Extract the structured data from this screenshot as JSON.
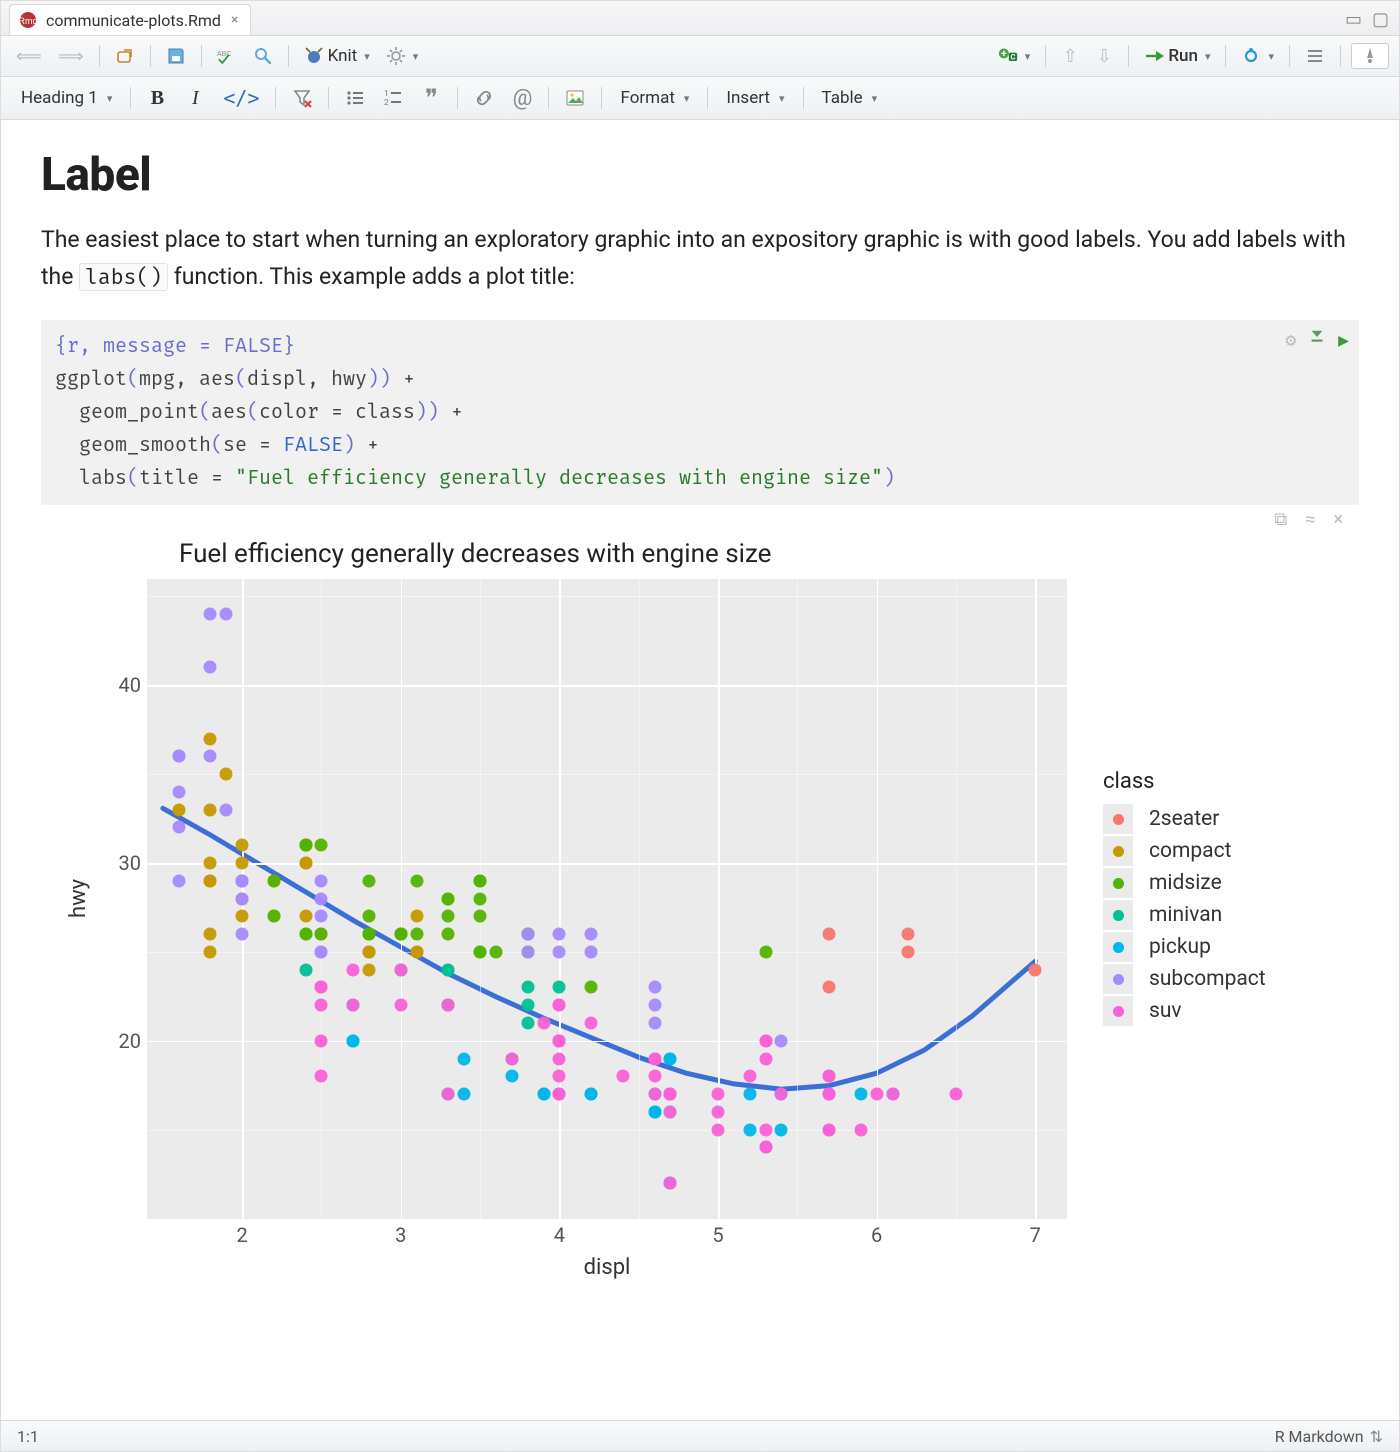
{
  "tabs": [
    {
      "label": "communicate-plots.Rmd"
    }
  ],
  "toolbar1": {
    "knit_label": "Knit",
    "run_label": "Run"
  },
  "toolbar2": {
    "heading_picker": "Heading 1",
    "format_menu": "Format",
    "insert_menu": "Insert",
    "table_menu": "Table"
  },
  "doc": {
    "heading": "Label",
    "p_before": "The easiest place to start when turning an exploratory graphic into an expository graphic is with good labels. You add labels with the ",
    "p_code": "labs()",
    "p_after": " function. This example adds a plot title:"
  },
  "chunk": {
    "header": "{r, message = FALSE}",
    "lines": [
      {
        "parts": [
          {
            "t": "fn",
            "v": "ggplot"
          },
          {
            "t": "paren",
            "v": "("
          },
          {
            "t": "arg",
            "v": "mpg, "
          },
          {
            "t": "fn",
            "v": "aes"
          },
          {
            "t": "paren",
            "v": "("
          },
          {
            "t": "arg",
            "v": "displ, hwy"
          },
          {
            "t": "paren",
            "v": "))"
          },
          {
            "t": "op",
            "v": " +"
          }
        ]
      },
      {
        "indent": 1,
        "parts": [
          {
            "t": "fn",
            "v": "geom_point"
          },
          {
            "t": "paren",
            "v": "("
          },
          {
            "t": "fn",
            "v": "aes"
          },
          {
            "t": "paren",
            "v": "("
          },
          {
            "t": "arg",
            "v": "color = class"
          },
          {
            "t": "paren",
            "v": "))"
          },
          {
            "t": "op",
            "v": " +"
          }
        ]
      },
      {
        "indent": 1,
        "parts": [
          {
            "t": "fn",
            "v": "geom_smooth"
          },
          {
            "t": "paren",
            "v": "("
          },
          {
            "t": "arg",
            "v": "se = "
          },
          {
            "t": "const",
            "v": "FALSE"
          },
          {
            "t": "paren",
            "v": ")"
          },
          {
            "t": "op",
            "v": " +"
          }
        ]
      },
      {
        "indent": 1,
        "parts": [
          {
            "t": "fn",
            "v": "labs"
          },
          {
            "t": "paren",
            "v": "("
          },
          {
            "t": "arg",
            "v": "title = "
          },
          {
            "t": "str",
            "v": "\"Fuel efficiency generally decreases with engine size\""
          },
          {
            "t": "paren",
            "v": ")"
          }
        ]
      }
    ]
  },
  "chart_data": {
    "type": "scatter",
    "title": "Fuel efficiency generally decreases with engine size",
    "xlabel": "displ",
    "ylabel": "hwy",
    "xlim": [
      1.4,
      7.2
    ],
    "ylim": [
      10,
      46
    ],
    "xticks": [
      2,
      3,
      4,
      5,
      6,
      7
    ],
    "yticks": [
      20,
      30,
      40
    ],
    "legend_title": "class",
    "colors": {
      "2seater": "#F8766D",
      "compact": "#C49A00",
      "midsize": "#53B400",
      "minivan": "#00C094",
      "pickup": "#00B6EB",
      "subcompact": "#A58AFF",
      "suv": "#FB61D7"
    },
    "series": [
      {
        "name": "2seater",
        "points": [
          {
            "x": 5.7,
            "y": 26
          },
          {
            "x": 5.7,
            "y": 23
          },
          {
            "x": 6.2,
            "y": 26
          },
          {
            "x": 6.2,
            "y": 25
          },
          {
            "x": 7.0,
            "y": 24
          }
        ]
      },
      {
        "name": "compact",
        "points": [
          {
            "x": 1.8,
            "y": 29
          },
          {
            "x": 1.8,
            "y": 29
          },
          {
            "x": 2.0,
            "y": 31
          },
          {
            "x": 2.0,
            "y": 30
          },
          {
            "x": 2.8,
            "y": 26
          },
          {
            "x": 2.8,
            "y": 26
          },
          {
            "x": 3.1,
            "y": 27
          },
          {
            "x": 1.8,
            "y": 26
          },
          {
            "x": 1.8,
            "y": 25
          },
          {
            "x": 2.0,
            "y": 28
          },
          {
            "x": 2.0,
            "y": 27
          },
          {
            "x": 2.8,
            "y": 25
          },
          {
            "x": 2.8,
            "y": 25
          },
          {
            "x": 3.1,
            "y": 25
          },
          {
            "x": 3.1,
            "y": 25
          },
          {
            "x": 2.4,
            "y": 30
          },
          {
            "x": 2.4,
            "y": 30
          },
          {
            "x": 2.5,
            "y": 26
          },
          {
            "x": 2.5,
            "y": 26
          },
          {
            "x": 1.8,
            "y": 37
          },
          {
            "x": 2.4,
            "y": 27
          },
          {
            "x": 2.2,
            "y": 29
          },
          {
            "x": 2.2,
            "y": 27
          },
          {
            "x": 2.4,
            "y": 31
          },
          {
            "x": 3.3,
            "y": 28
          },
          {
            "x": 1.6,
            "y": 33
          },
          {
            "x": 1.8,
            "y": 33
          },
          {
            "x": 1.8,
            "y": 30
          },
          {
            "x": 2.0,
            "y": 29
          },
          {
            "x": 2.0,
            "y": 29
          },
          {
            "x": 2.8,
            "y": 24
          },
          {
            "x": 1.9,
            "y": 35
          }
        ]
      },
      {
        "name": "midsize",
        "points": [
          {
            "x": 2.8,
            "y": 26
          },
          {
            "x": 2.8,
            "y": 26
          },
          {
            "x": 2.8,
            "y": 27
          },
          {
            "x": 3.0,
            "y": 26
          },
          {
            "x": 3.1,
            "y": 26
          },
          {
            "x": 4.2,
            "y": 23
          },
          {
            "x": 2.4,
            "y": 26
          },
          {
            "x": 2.4,
            "y": 31
          },
          {
            "x": 3.1,
            "y": 29
          },
          {
            "x": 2.4,
            "y": 26
          },
          {
            "x": 2.4,
            "y": 31
          },
          {
            "x": 3.5,
            "y": 29
          },
          {
            "x": 3.6,
            "y": 25
          },
          {
            "x": 3.5,
            "y": 28
          },
          {
            "x": 3.0,
            "y": 26
          },
          {
            "x": 3.0,
            "y": 26
          },
          {
            "x": 3.3,
            "y": 27
          },
          {
            "x": 3.3,
            "y": 26
          },
          {
            "x": 3.3,
            "y": 28
          },
          {
            "x": 3.8,
            "y": 25
          },
          {
            "x": 3.8,
            "y": 26
          },
          {
            "x": 3.8,
            "y": 26
          },
          {
            "x": 3.8,
            "y": 26
          },
          {
            "x": 2.2,
            "y": 29
          },
          {
            "x": 2.2,
            "y": 27
          },
          {
            "x": 2.4,
            "y": 31
          },
          {
            "x": 2.4,
            "y": 31
          },
          {
            "x": 3.0,
            "y": 26
          },
          {
            "x": 3.0,
            "y": 26
          },
          {
            "x": 5.3,
            "y": 25
          },
          {
            "x": 2.8,
            "y": 29
          },
          {
            "x": 3.5,
            "y": 25
          },
          {
            "x": 2.5,
            "y": 31
          },
          {
            "x": 3.5,
            "y": 29
          },
          {
            "x": 3.5,
            "y": 27
          },
          {
            "x": 3.5,
            "y": 25
          },
          {
            "x": 2.5,
            "y": 26
          }
        ]
      },
      {
        "name": "minivan",
        "points": [
          {
            "x": 2.4,
            "y": 24
          },
          {
            "x": 3.0,
            "y": 24
          },
          {
            "x": 3.3,
            "y": 22
          },
          {
            "x": 3.3,
            "y": 22
          },
          {
            "x": 3.3,
            "y": 24
          },
          {
            "x": 3.3,
            "y": 24
          },
          {
            "x": 3.3,
            "y": 17
          },
          {
            "x": 3.8,
            "y": 22
          },
          {
            "x": 3.8,
            "y": 21
          },
          {
            "x": 3.8,
            "y": 23
          },
          {
            "x": 4.0,
            "y": 23
          }
        ]
      },
      {
        "name": "pickup",
        "points": [
          {
            "x": 3.7,
            "y": 19
          },
          {
            "x": 3.7,
            "y": 18
          },
          {
            "x": 3.9,
            "y": 17
          },
          {
            "x": 3.9,
            "y": 17
          },
          {
            "x": 4.7,
            "y": 19
          },
          {
            "x": 4.7,
            "y": 19
          },
          {
            "x": 4.7,
            "y": 12
          },
          {
            "x": 5.2,
            "y": 17
          },
          {
            "x": 5.2,
            "y": 15
          },
          {
            "x": 5.9,
            "y": 17
          },
          {
            "x": 4.7,
            "y": 17
          },
          {
            "x": 4.7,
            "y": 17
          },
          {
            "x": 4.7,
            "y": 16
          },
          {
            "x": 4.7,
            "y": 12
          },
          {
            "x": 4.2,
            "y": 17
          },
          {
            "x": 4.2,
            "y": 17
          },
          {
            "x": 4.6,
            "y": 16
          },
          {
            "x": 4.6,
            "y": 16
          },
          {
            "x": 4.6,
            "y": 17
          },
          {
            "x": 5.4,
            "y": 17
          },
          {
            "x": 5.4,
            "y": 15
          },
          {
            "x": 2.7,
            "y": 20
          },
          {
            "x": 2.7,
            "y": 20
          },
          {
            "x": 2.7,
            "y": 22
          },
          {
            "x": 3.4,
            "y": 17
          },
          {
            "x": 3.4,
            "y": 19
          },
          {
            "x": 4.0,
            "y": 20
          },
          {
            "x": 4.0,
            "y": 17
          },
          {
            "x": 4.0,
            "y": 20
          },
          {
            "x": 4.7,
            "y": 17
          },
          {
            "x": 5.7,
            "y": 17
          },
          {
            "x": 6.1,
            "y": 17
          }
        ]
      },
      {
        "name": "subcompact",
        "points": [
          {
            "x": 3.8,
            "y": 26
          },
          {
            "x": 3.8,
            "y": 25
          },
          {
            "x": 4.0,
            "y": 26
          },
          {
            "x": 4.0,
            "y": 25
          },
          {
            "x": 4.6,
            "y": 23
          },
          {
            "x": 4.6,
            "y": 22
          },
          {
            "x": 1.6,
            "y": 29
          },
          {
            "x": 1.6,
            "y": 32
          },
          {
            "x": 1.6,
            "y": 34
          },
          {
            "x": 1.6,
            "y": 36
          },
          {
            "x": 1.6,
            "y": 36
          },
          {
            "x": 1.8,
            "y": 36
          },
          {
            "x": 4.6,
            "y": 21
          },
          {
            "x": 4.2,
            "y": 25
          },
          {
            "x": 4.2,
            "y": 26
          },
          {
            "x": 5.4,
            "y": 20
          },
          {
            "x": 2.0,
            "y": 26
          },
          {
            "x": 2.0,
            "y": 29
          },
          {
            "x": 1.9,
            "y": 33
          },
          {
            "x": 2.0,
            "y": 28
          },
          {
            "x": 2.5,
            "y": 28
          },
          {
            "x": 2.5,
            "y": 25
          },
          {
            "x": 2.5,
            "y": 27
          },
          {
            "x": 2.5,
            "y": 25
          },
          {
            "x": 1.8,
            "y": 41
          },
          {
            "x": 1.8,
            "y": 44
          },
          {
            "x": 1.9,
            "y": 44
          },
          {
            "x": 2.0,
            "y": 29
          },
          {
            "x": 2.5,
            "y": 29
          }
        ]
      },
      {
        "name": "suv",
        "points": [
          {
            "x": 5.3,
            "y": 20
          },
          {
            "x": 5.3,
            "y": 15
          },
          {
            "x": 5.3,
            "y": 20
          },
          {
            "x": 5.7,
            "y": 17
          },
          {
            "x": 6.0,
            "y": 17
          },
          {
            "x": 5.7,
            "y": 15
          },
          {
            "x": 5.3,
            "y": 14
          },
          {
            "x": 5.3,
            "y": 19
          },
          {
            "x": 5.3,
            "y": 14
          },
          {
            "x": 5.7,
            "y": 15
          },
          {
            "x": 6.5,
            "y": 17
          },
          {
            "x": 3.9,
            "y": 21
          },
          {
            "x": 4.7,
            "y": 16
          },
          {
            "x": 4.7,
            "y": 12
          },
          {
            "x": 4.7,
            "y": 17
          },
          {
            "x": 5.2,
            "y": 18
          },
          {
            "x": 5.7,
            "y": 18
          },
          {
            "x": 5.9,
            "y": 15
          },
          {
            "x": 5.0,
            "y": 16
          },
          {
            "x": 4.0,
            "y": 17
          },
          {
            "x": 4.0,
            "y": 19
          },
          {
            "x": 4.6,
            "y": 17
          },
          {
            "x": 5.0,
            "y": 17
          },
          {
            "x": 5.4,
            "y": 17
          },
          {
            "x": 4.0,
            "y": 22
          },
          {
            "x": 4.0,
            "y": 22
          },
          {
            "x": 4.0,
            "y": 20
          },
          {
            "x": 4.0,
            "y": 17
          },
          {
            "x": 4.6,
            "y": 19
          },
          {
            "x": 5.0,
            "y": 15
          },
          {
            "x": 4.2,
            "y": 21
          },
          {
            "x": 4.4,
            "y": 18
          },
          {
            "x": 4.6,
            "y": 18
          },
          {
            "x": 4.6,
            "y": 19
          },
          {
            "x": 4.6,
            "y": 19
          },
          {
            "x": 3.0,
            "y": 22
          },
          {
            "x": 3.7,
            "y": 19
          },
          {
            "x": 4.0,
            "y": 20
          },
          {
            "x": 4.7,
            "y": 17
          },
          {
            "x": 5.7,
            "y": 18
          },
          {
            "x": 6.1,
            "y": 17
          },
          {
            "x": 2.7,
            "y": 24
          },
          {
            "x": 2.7,
            "y": 22
          },
          {
            "x": 3.0,
            "y": 24
          },
          {
            "x": 3.3,
            "y": 22
          },
          {
            "x": 4.0,
            "y": 18
          },
          {
            "x": 3.3,
            "y": 17
          },
          {
            "x": 2.5,
            "y": 22
          },
          {
            "x": 2.5,
            "y": 23
          },
          {
            "x": 2.5,
            "y": 23
          },
          {
            "x": 4.7,
            "y": 17
          },
          {
            "x": 5.7,
            "y": 17
          },
          {
            "x": 4.0,
            "y": 20
          },
          {
            "x": 4.7,
            "y": 17
          },
          {
            "x": 4.0,
            "y": 20
          },
          {
            "x": 2.5,
            "y": 18
          },
          {
            "x": 2.5,
            "y": 20
          }
        ]
      }
    ],
    "smooth": [
      {
        "x": 1.5,
        "y": 33.1
      },
      {
        "x": 1.8,
        "y": 31.6
      },
      {
        "x": 2.1,
        "y": 30.0
      },
      {
        "x": 2.4,
        "y": 28.4
      },
      {
        "x": 2.7,
        "y": 26.8
      },
      {
        "x": 3.0,
        "y": 25.3
      },
      {
        "x": 3.3,
        "y": 23.8
      },
      {
        "x": 3.6,
        "y": 22.5
      },
      {
        "x": 3.9,
        "y": 21.3
      },
      {
        "x": 4.2,
        "y": 20.2
      },
      {
        "x": 4.5,
        "y": 19.1
      },
      {
        "x": 4.8,
        "y": 18.2
      },
      {
        "x": 5.1,
        "y": 17.6
      },
      {
        "x": 5.4,
        "y": 17.3
      },
      {
        "x": 5.7,
        "y": 17.5
      },
      {
        "x": 6.0,
        "y": 18.2
      },
      {
        "x": 6.3,
        "y": 19.5
      },
      {
        "x": 6.6,
        "y": 21.4
      },
      {
        "x": 7.0,
        "y": 24.5
      }
    ]
  },
  "statusbar": {
    "cursor": "1:1",
    "mode": "R Markdown"
  }
}
